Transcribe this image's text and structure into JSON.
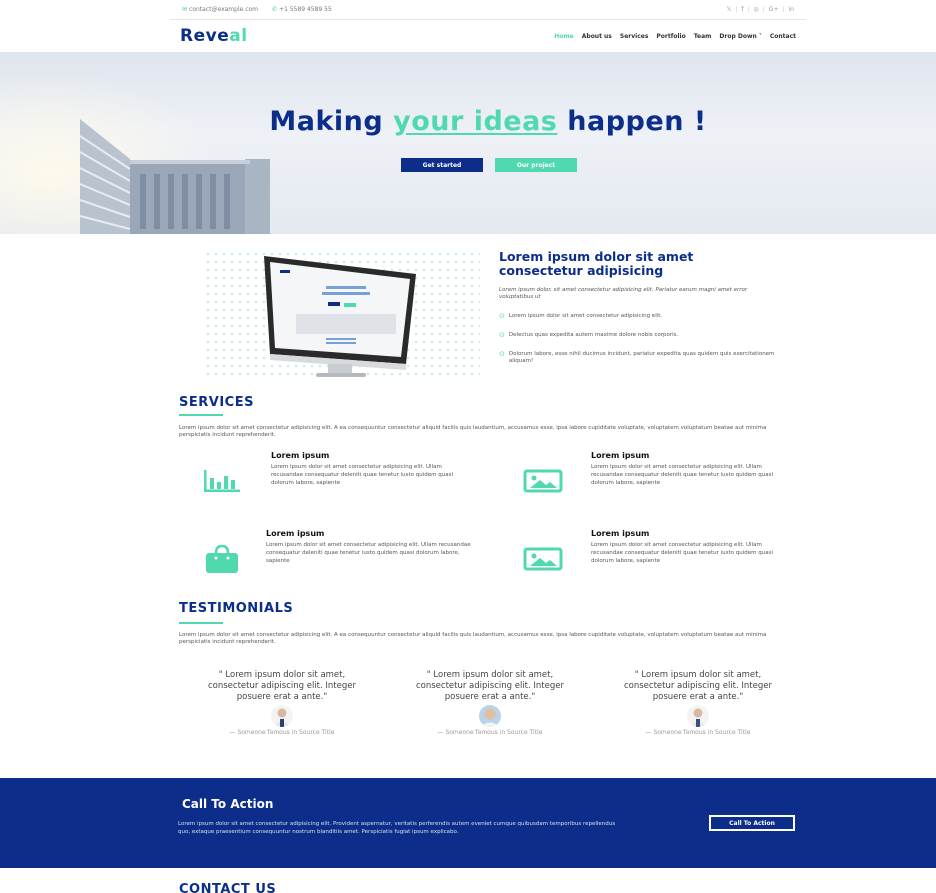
{
  "topbar": {
    "email": "contact@example.com",
    "phone": "+1 5589 4589 55",
    "social_icons": [
      "twitter-icon",
      "facebook-icon",
      "instagram-icon",
      "google-plus-icon",
      "linkedin-icon"
    ],
    "social_labels": [
      "𝕏",
      "f",
      "◎",
      "G+",
      "in"
    ]
  },
  "header": {
    "logo_part1": "Reve",
    "logo_part2": "al",
    "nav": [
      "Home",
      "About us",
      "Services",
      "Portfolio",
      "Team",
      "Drop Down ˅",
      "Contact"
    ]
  },
  "hero": {
    "title_pre": "Making ",
    "title_highlight": "your ideas",
    "title_post": " happen !",
    "btn_start": "Get started",
    "btn_project": "Our project"
  },
  "about": {
    "title": "Lorem ipsum dolor sit amet consectetur adipisicing",
    "subtitle": "Lorem ipsum dolor, sit amet consectetur adipisicing elit. Pariatur earum magni amet error voluptatibus ut",
    "items": [
      "Lorem ipsum dolor sit amet consectetur adipisicing elit.",
      "Delectus quas expedita autem maxime dolore nobis corporis.",
      "Dolorum labore, esse nihil ducimus incidunt, pariatur expedita quas quidem quis exercitationem aliquam!"
    ],
    "check_icon": "check-circle-icon"
  },
  "services": {
    "title": "SERVICES",
    "description": "Lorem ipsum dolor sit amet consectetur adipisicing elit. A ea consequuntur consectetur aliquid facilis quis laudantium, accusamus esse, ipsa labore cupiditate voluptate, voluptatem voluptatum beatae aut minima perspiciatis incidunt reprehenderit.",
    "items": [
      {
        "icon": "bar-chart-icon",
        "title": "Lorem ipsum",
        "text": "Lorem ipsum dolor sit amet consectetur adipisicing elit. Ullam recusandae consequatur deleniti quae tenetur iusto quidem quasi dolorum labore, sapiente"
      },
      {
        "icon": "image-icon",
        "title": "Lorem ipsum",
        "text": "Lorem ipsum dolor sit amet consectetur adipisicing elit. Ullam recusandae consequatur deleniti quae tenetur iusto quidem quasi dolorum labore, sapiente"
      },
      {
        "icon": "shopping-bag-icon",
        "title": "Lorem ipsum",
        "text": "Lorem ipsum dolor sit amet consectetur adipisicing elit. Ullam recusandae consequatur deleniti quae tenetur iusto quidem quasi dolorum labore, sapiente"
      },
      {
        "icon": "image-icon",
        "title": "Lorem ipsum",
        "text": "Lorem ipsum dolor sit amet consectetur adipisicing elit. Ullam recusandae consequatur deleniti quae tenetur iusto quidem quasi dolorum labore, sapiente"
      }
    ]
  },
  "testimonials": {
    "title": "TESTIMONIALS",
    "description": "Lorem ipsum dolor sit amet consectetur adipisicing elit. A ea consequuntur consectetur aliquid facilis quis laudantium, accusamus esse, ipsa labore cupiditate voluptate, voluptatem voluptatum beatae aut minima perspiciatis incidunt reprehenderit.",
    "items": [
      {
        "quote": "\" Lorem ipsum dolor sit amet, consectetur adipiscing elit. Integer posuere erat a ante.\"",
        "author": "— Someone famous in Source Title"
      },
      {
        "quote": "\" Lorem ipsum dolor sit amet, consectetur adipiscing elit. Integer posuere erat a ante.\"",
        "author": "— Someone famous in Source Title"
      },
      {
        "quote": "\" Lorem ipsum dolor sit amet, consectetur adipiscing elit. Integer posuere erat a ante.\"",
        "author": "— Someone famous in Source Title"
      }
    ]
  },
  "cta": {
    "title": "Call To Action",
    "text": "Lorem ipsum dolor sit amet consectetur adipisicing elit. Provident aspernatur, veritatis perferendis autem eveniet cumque quibusdam temporibus repellendus quo, extaque praesentium consequuntur nostrum blanditiis amet. Perspiciatis fugiat ipsum explicabo.",
    "button": "Call To Action"
  },
  "contact": {
    "title": "CONTACT US"
  },
  "colors": {
    "primary": "#0c2e8a",
    "accent": "#50d8af"
  }
}
